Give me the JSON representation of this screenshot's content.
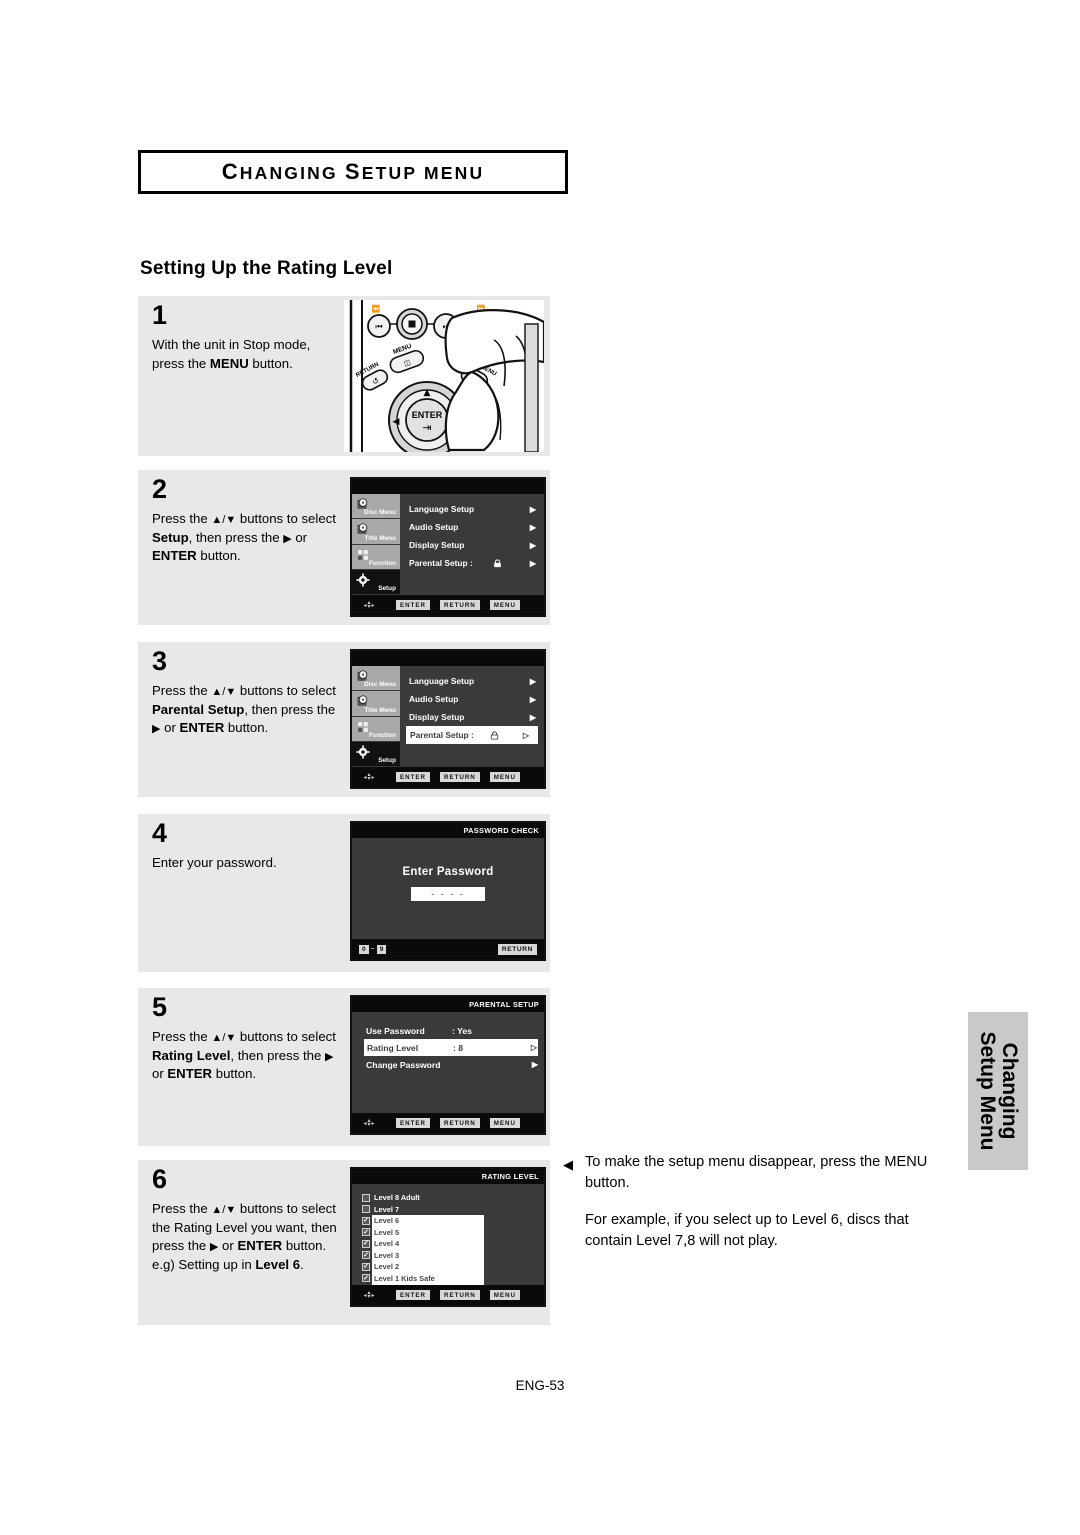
{
  "header": {
    "section_title": "CHANGING SETUP MENU",
    "page_title": "Setting Up the Rating Level"
  },
  "footer": {
    "page_number": "ENG-53"
  },
  "side_tab": {
    "line1": "Changing",
    "line2": "Setup Menu"
  },
  "note": {
    "paragraph1": "To make the setup menu disappear, press the MENU button.",
    "paragraph2": "For example, if you select up to Level 6, discs that contain Level 7,8 will not play."
  },
  "steps": [
    {
      "number": "1",
      "text_parts": [
        {
          "t": "With the unit in Stop mode, press the ",
          "b": false
        },
        {
          "t": "MENU",
          "b": true
        },
        {
          "t": " button.",
          "b": false
        }
      ],
      "media": "remote-photo"
    },
    {
      "number": "2",
      "text_parts": [
        {
          "t": "Press the ",
          "b": false
        },
        {
          "t": "▲/▼",
          "b": false
        },
        {
          "t": " buttons to select ",
          "b": false
        },
        {
          "t": "Setup",
          "b": true
        },
        {
          "t": ", then press the ",
          "b": false
        },
        {
          "t": "▶",
          "b": false
        },
        {
          "t": " or ",
          "b": false
        },
        {
          "t": "ENTER",
          "b": true
        },
        {
          "t": " button.",
          "b": false
        }
      ],
      "media": "osd-setup"
    },
    {
      "number": "3",
      "text_parts": [
        {
          "t": "Press the ",
          "b": false
        },
        {
          "t": "▲/▼",
          "b": false
        },
        {
          "t": " buttons to select ",
          "b": false
        },
        {
          "t": "Parental Setup",
          "b": true
        },
        {
          "t": ", then press the ",
          "b": false
        },
        {
          "t": "▶",
          "b": false
        },
        {
          "t": " or ",
          "b": false
        },
        {
          "t": "ENTER",
          "b": true
        },
        {
          "t": " button.",
          "b": false
        }
      ],
      "media": "osd-setup-parental"
    },
    {
      "number": "4",
      "text_parts": [
        {
          "t": "Enter your password.",
          "b": false
        }
      ],
      "media": "osd-password"
    },
    {
      "number": "5",
      "text_parts": [
        {
          "t": "Press the ",
          "b": false
        },
        {
          "t": "▲/▼",
          "b": false
        },
        {
          "t": " buttons to select ",
          "b": false
        },
        {
          "t": "Rating Level",
          "b": true
        },
        {
          "t": ", then press the ",
          "b": false
        },
        {
          "t": "▶",
          "b": false
        },
        {
          "t": " or ",
          "b": false
        },
        {
          "t": "ENTER",
          "b": true
        },
        {
          "t": " button.",
          "b": false
        }
      ],
      "media": "osd-parental-setup"
    },
    {
      "number": "6",
      "text_parts": [
        {
          "t": "Press the ",
          "b": false
        },
        {
          "t": "▲/▼",
          "b": false
        },
        {
          "t": " buttons to select the Rating Level you want, then press the ",
          "b": false
        },
        {
          "t": "▶",
          "b": false
        },
        {
          "t": " or ",
          "b": false
        },
        {
          "t": "ENTER",
          "b": true
        },
        {
          "t": " button. ",
          "b": false
        },
        {
          "t": "e.g) Setting up in ",
          "b": false
        },
        {
          "t": "Level 6",
          "b": true
        },
        {
          "t": ".",
          "b": false
        }
      ],
      "media": "osd-rating-level"
    }
  ],
  "osd": {
    "sidebar": [
      {
        "label": "Disc Menu",
        "icon": "disc-icon",
        "active": false
      },
      {
        "label": "Title Menu",
        "icon": "disc-icon",
        "active": false
      },
      {
        "label": "Function",
        "icon": "grid-icon",
        "active": false
      },
      {
        "label": "Setup",
        "icon": "gear-icon",
        "active": true
      }
    ],
    "bottom_buttons": [
      "ENTER",
      "RETURN",
      "MENU"
    ],
    "setup_menu": {
      "rows": [
        {
          "label": "Language Setup",
          "value": "",
          "arrow": "▶",
          "highlight": false,
          "lock": false
        },
        {
          "label": "Audio Setup",
          "value": "",
          "arrow": "▶",
          "highlight": false,
          "lock": false
        },
        {
          "label": "Display Setup",
          "value": "",
          "arrow": "▶",
          "highlight": false,
          "lock": false
        },
        {
          "label": "Parental Setup :",
          "value": "",
          "arrow": "▶",
          "highlight": false,
          "lock": true
        }
      ]
    },
    "setup_menu_parental": {
      "rows": [
        {
          "label": "Language Setup",
          "value": "",
          "arrow": "▶",
          "highlight": false,
          "lock": false
        },
        {
          "label": "Audio Setup",
          "value": "",
          "arrow": "▶",
          "highlight": false,
          "lock": false
        },
        {
          "label": "Display Setup",
          "value": "",
          "arrow": "▶",
          "highlight": false,
          "lock": false
        },
        {
          "label": "Parental Setup :",
          "value": "",
          "arrow": "▷",
          "highlight": true,
          "lock": true
        }
      ]
    },
    "password_screen": {
      "title": "PASSWORD CHECK",
      "prompt": "Enter Password",
      "field_value": "- - - -",
      "digit_range_from": "0",
      "digit_range_tilde": "~",
      "digit_range_to": "9",
      "return_label": "RETURN"
    },
    "parental_setup_screen": {
      "title": "PARENTAL SETUP",
      "rows": [
        {
          "name": "Use Password",
          "value": ": Yes",
          "arrow": "",
          "highlight": false
        },
        {
          "name": "Rating Level",
          "value": ": 8",
          "arrow": "▷",
          "highlight": true
        },
        {
          "name": "Change Password",
          "value": "",
          "arrow": "▶",
          "highlight": false
        }
      ]
    },
    "rating_level_screen": {
      "title": "RATING LEVEL",
      "items": [
        {
          "label": "Level 8 Adult",
          "checked": false,
          "on_white": false
        },
        {
          "label": "Level 7",
          "checked": false,
          "on_white": false
        },
        {
          "label": "Level 6",
          "checked": true,
          "on_white": true
        },
        {
          "label": "Level 5",
          "checked": true,
          "on_white": true
        },
        {
          "label": "Level 4",
          "checked": true,
          "on_white": true
        },
        {
          "label": "Level 3",
          "checked": true,
          "on_white": true
        },
        {
          "label": "Level 2",
          "checked": true,
          "on_white": true
        },
        {
          "label": "Level 1 Kids Safe",
          "checked": true,
          "on_white": true
        }
      ],
      "check_glyph": "✓"
    }
  },
  "remote": {
    "buttons": [
      "MENU",
      "RETURN",
      "DISC MENU",
      "ENTER"
    ]
  }
}
